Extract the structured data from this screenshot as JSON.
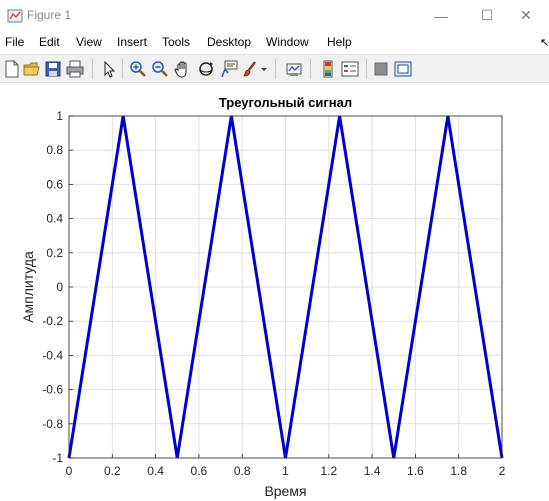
{
  "window": {
    "title": "Figure 1",
    "minimize_glyph": "—",
    "maximize_glyph": "☐",
    "close_glyph": "✕"
  },
  "menu": {
    "items": [
      "File",
      "Edit",
      "View",
      "Insert",
      "Tools",
      "Desktop",
      "Window",
      "Help"
    ],
    "overflow_glyph": "↖"
  },
  "toolbar": {
    "buttons": [
      "new-figure-icon",
      "open-file-icon",
      "save-icon",
      "print-icon",
      "select-arrow-icon",
      "zoom-in-icon",
      "zoom-out-icon",
      "pan-hand-icon",
      "rotate-3d-icon",
      "data-cursor-icon",
      "brush-icon",
      "link-plot-icon",
      "colorbar-icon",
      "legend-icon",
      "hide-plot-tools-icon",
      "show-plot-tools-icon"
    ]
  },
  "chart_data": {
    "type": "line",
    "title": "Треугольный сигнал",
    "xlabel": "Время",
    "ylabel": "Амплитуда",
    "xlim": [
      0,
      2
    ],
    "ylim": [
      -1,
      1
    ],
    "x_ticks": [
      "0",
      "0.2",
      "0.4",
      "0.6",
      "0.8",
      "1",
      "1.2",
      "1.4",
      "1.6",
      "1.8",
      "2"
    ],
    "y_ticks": [
      "-1",
      "-0.8",
      "-0.6",
      "-0.4",
      "-0.2",
      "0",
      "0.2",
      "0.4",
      "0.6",
      "0.8",
      "1"
    ],
    "grid": true,
    "series": [
      {
        "color": "#0000cc",
        "x": [
          0,
          0.25,
          0.5,
          0.75,
          1.0,
          1.25,
          1.5,
          1.75,
          2.0
        ],
        "y": [
          -1,
          1,
          -1,
          1,
          -1,
          1,
          -1,
          1,
          -1
        ]
      }
    ]
  }
}
